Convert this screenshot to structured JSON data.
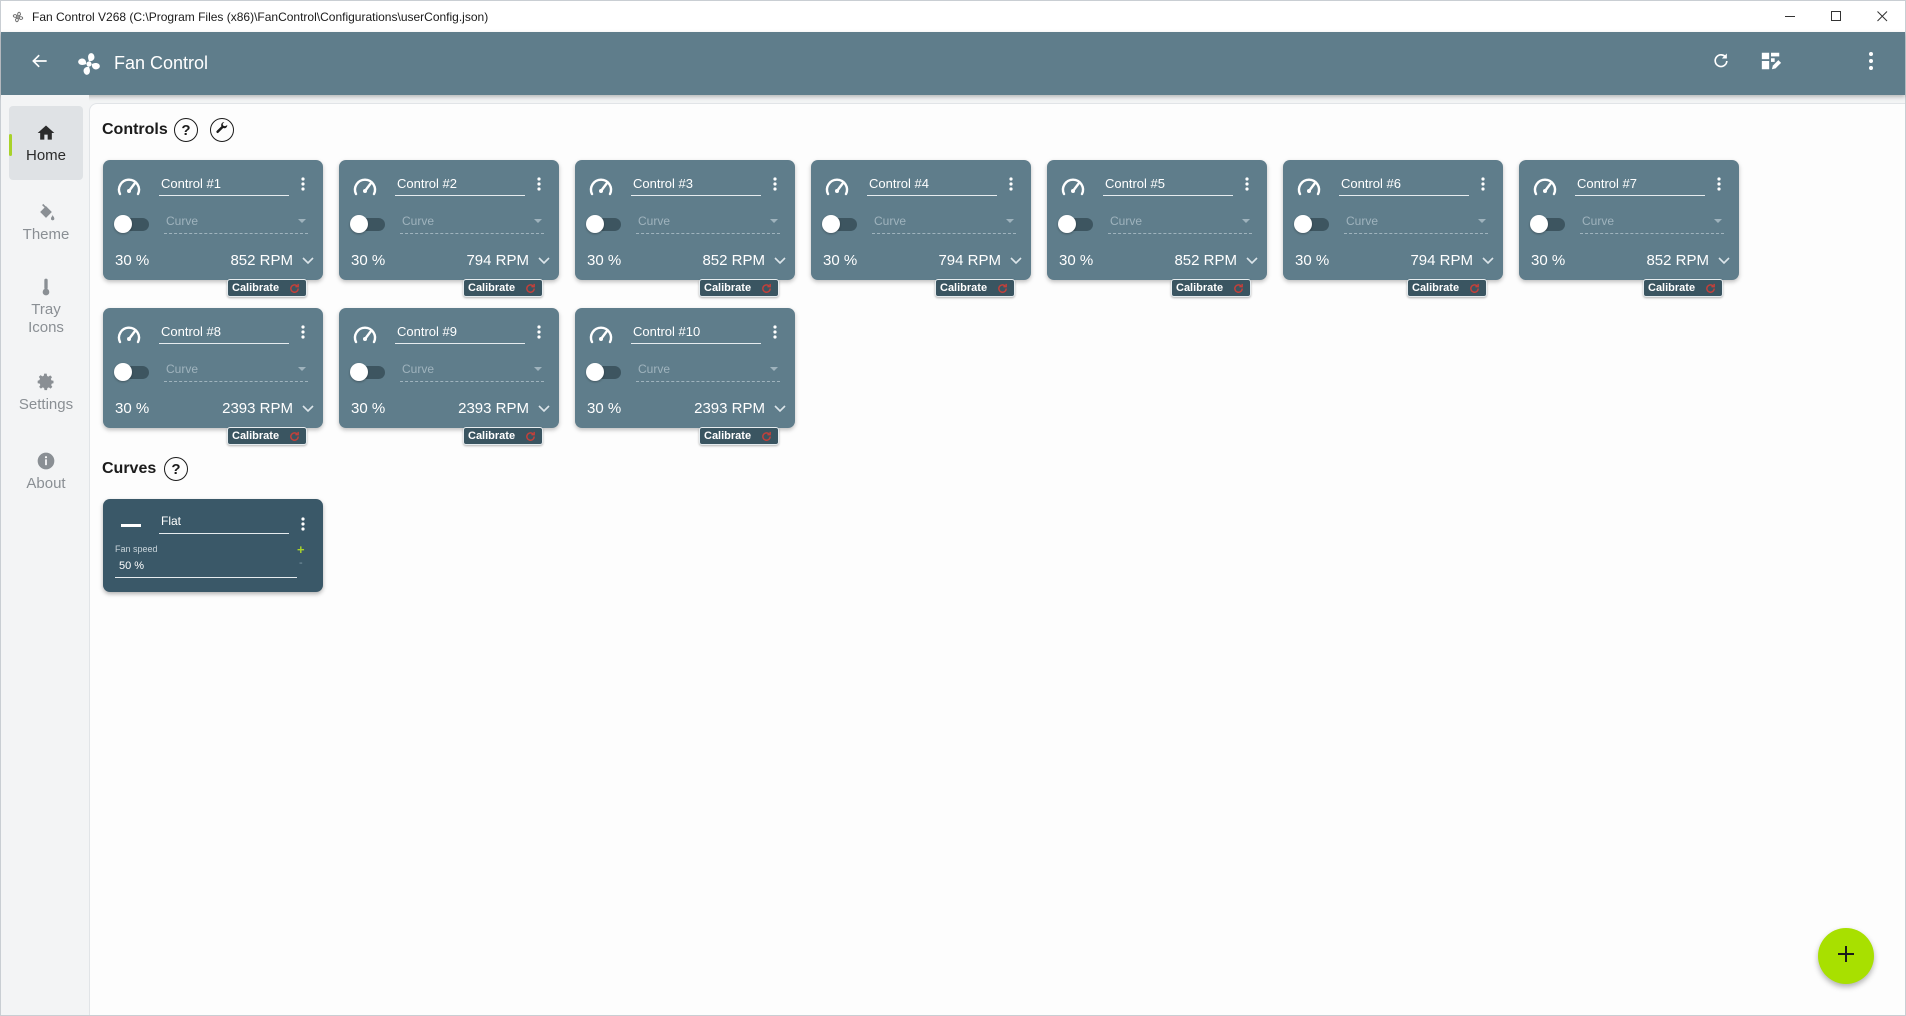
{
  "window": {
    "title": "Fan Control V268 (C:\\Program Files (x86)\\FanControl\\Configurations\\userConfig.json)"
  },
  "appbar": {
    "title": "Fan Control",
    "icons": [
      "arrow-left-icon",
      "fan-logo-icon",
      "refresh-icon",
      "layout-edit-icon",
      "more-vertical-icon"
    ]
  },
  "sidebar": {
    "items": [
      {
        "label": "Home",
        "icon": "home-icon",
        "active": true
      },
      {
        "label": "Theme",
        "icon": "paint-bucket-icon",
        "active": false
      },
      {
        "label": "Tray Icons",
        "icon": "thermometer-icon",
        "active": false
      },
      {
        "label": "Settings",
        "icon": "gear-icon",
        "active": false
      },
      {
        "label": "About",
        "icon": "info-icon",
        "active": false
      }
    ]
  },
  "controls_section": {
    "title": "Controls",
    "help": "?",
    "calibrate_label": "Calibrate",
    "curve_placeholder": "Curve",
    "items": [
      {
        "name": "Control #1",
        "percent": "30 %",
        "rpm": "852 RPM"
      },
      {
        "name": "Control #2",
        "percent": "30 %",
        "rpm": "794 RPM"
      },
      {
        "name": "Control #3",
        "percent": "30 %",
        "rpm": "852 RPM"
      },
      {
        "name": "Control #4",
        "percent": "30 %",
        "rpm": "794 RPM"
      },
      {
        "name": "Control #5",
        "percent": "30 %",
        "rpm": "852 RPM"
      },
      {
        "name": "Control #6",
        "percent": "30 %",
        "rpm": "794 RPM"
      },
      {
        "name": "Control #7",
        "percent": "30 %",
        "rpm": "852 RPM"
      },
      {
        "name": "Control #8",
        "percent": "30 %",
        "rpm": "2393 RPM"
      },
      {
        "name": "Control #9",
        "percent": "30 %",
        "rpm": "2393 RPM"
      },
      {
        "name": "Control #10",
        "percent": "30 %",
        "rpm": "2393 RPM"
      }
    ]
  },
  "curves_section": {
    "title": "Curves",
    "help": "?",
    "items": [
      {
        "name": "Flat",
        "field_label": "Fan speed",
        "field_value": "50 %",
        "plus": "+",
        "minus": "-"
      }
    ]
  },
  "colors": {
    "primary": "#5f7d8b",
    "accent": "#a8e000",
    "curve_card": "#3a5868"
  }
}
